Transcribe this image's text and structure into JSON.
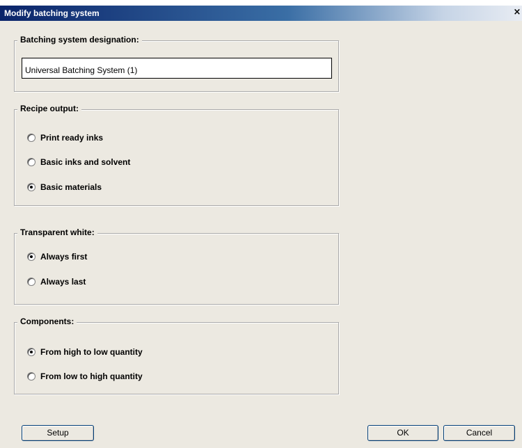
{
  "window": {
    "title": "Modify batching system",
    "close_glyph": "×"
  },
  "designation": {
    "legend": "Batching system designation:",
    "value": "Universal Batching System (1)"
  },
  "recipe_output": {
    "legend": "Recipe output:",
    "options": [
      {
        "label": "Print ready inks",
        "checked": false
      },
      {
        "label": "Basic inks and solvent",
        "checked": false
      },
      {
        "label": "Basic materials",
        "checked": true
      }
    ]
  },
  "transparent_white": {
    "legend": "Transparent white:",
    "options": [
      {
        "label": "Always first",
        "checked": true
      },
      {
        "label": "Always last",
        "checked": false
      }
    ]
  },
  "components": {
    "legend": "Components:",
    "options": [
      {
        "label": "From high to low quantity",
        "checked": true
      },
      {
        "label": "From low to high quantity",
        "checked": false
      }
    ]
  },
  "buttons": {
    "setup": "Setup",
    "ok": "OK",
    "cancel": "Cancel"
  }
}
